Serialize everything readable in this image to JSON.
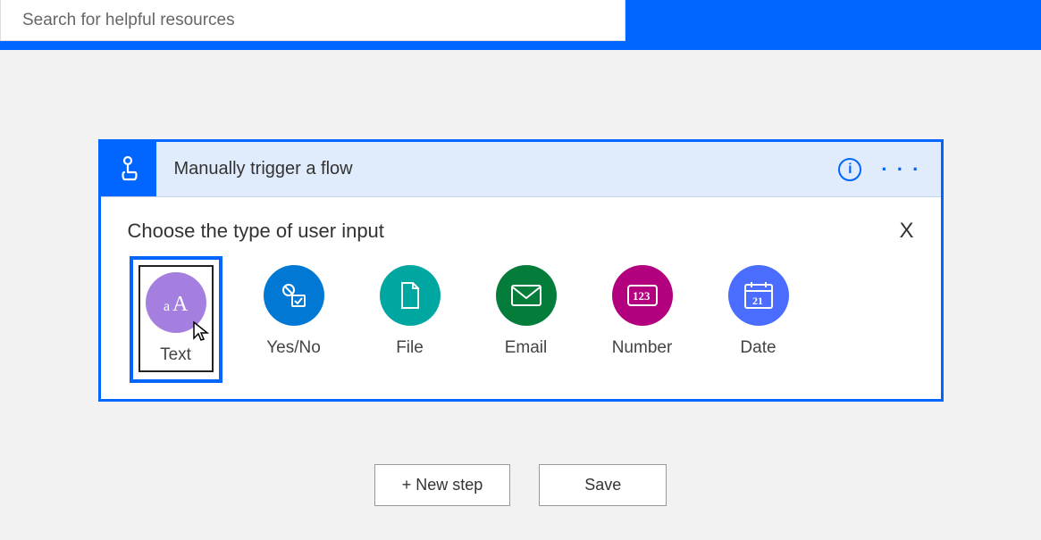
{
  "search": {
    "placeholder": "Search for helpful resources"
  },
  "trigger": {
    "title": "Manually trigger a flow",
    "choose_label": "Choose the type of user input",
    "close": "X"
  },
  "input_types": {
    "text": {
      "label": "Text"
    },
    "yesno": {
      "label": "Yes/No"
    },
    "file": {
      "label": "File"
    },
    "email": {
      "label": "Email"
    },
    "number": {
      "label": "Number"
    },
    "date": {
      "label": "Date",
      "day": "21"
    }
  },
  "footer": {
    "new_step": "+ New step",
    "save": "Save"
  },
  "info_glyph": "i",
  "ellipsis_glyph": "· · ·"
}
